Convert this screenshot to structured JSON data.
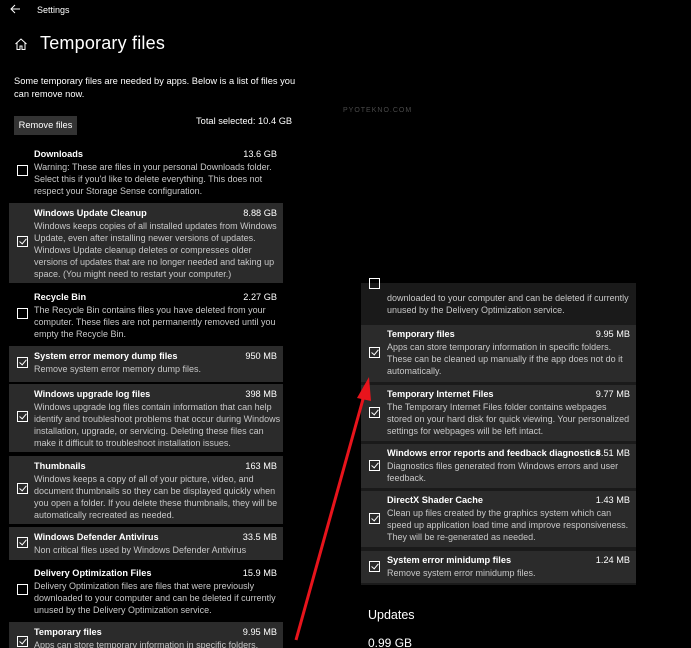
{
  "titlebar": {
    "app_title": "Settings",
    "back_icon": "back-arrow-icon"
  },
  "page": {
    "title": "Temporary files",
    "intro": "Some temporary files are needed by apps. Below is a list of files you can remove now.",
    "remove_button": "Remove files",
    "total_selected": "Total selected: 10.4 GB",
    "watermark": "PYOTEKNO.COM"
  },
  "items": [
    {
      "name": "Downloads",
      "size": "13.6 GB",
      "checked": false,
      "selected": false,
      "desc": "Warning: These are files in your personal Downloads folder. Select this if you'd like to delete everything. This does not respect your Storage Sense configuration."
    },
    {
      "name": "Windows Update Cleanup",
      "size": "8.88 GB",
      "checked": true,
      "selected": true,
      "desc": "Windows keeps copies of all installed updates from Windows Update, even after installing newer versions of updates. Windows Update cleanup deletes or compresses older versions of updates that are no longer needed and taking up space. (You might need to restart your computer.)"
    },
    {
      "name": "Recycle Bin",
      "size": "2.27 GB",
      "checked": false,
      "selected": false,
      "desc": "The Recycle Bin contains files you have deleted from your computer. These files are not permanently removed until you empty the Recycle Bin."
    },
    {
      "name": "System error memory dump files",
      "size": "950 MB",
      "checked": true,
      "selected": true,
      "desc": "Remove system error memory dump files."
    },
    {
      "name": "Windows upgrade log files",
      "size": "398 MB",
      "checked": true,
      "selected": true,
      "desc": "Windows upgrade log files contain information that can help identify and troubleshoot problems that occur during Windows installation, upgrade, or servicing.  Deleting these files can make it difficult to troubleshoot installation issues."
    },
    {
      "name": "Thumbnails",
      "size": "163 MB",
      "checked": true,
      "selected": true,
      "desc": "Windows keeps a copy of all of your picture, video, and document thumbnails so they can be displayed quickly when you open a folder. If you delete these thumbnails, they will be automatically recreated as needed."
    },
    {
      "name": "Windows Defender Antivirus",
      "size": "33.5 MB",
      "checked": true,
      "selected": true,
      "desc": "Non critical files used by Windows Defender Antivirus"
    },
    {
      "name": "Delivery Optimization Files",
      "size": "15.9 MB",
      "checked": false,
      "selected": false,
      "desc": "Delivery Optimization files are files that were previously downloaded to your computer and can be deleted if currently unused by the Delivery Optimization service."
    },
    {
      "name": "Temporary files",
      "size": "9.95 MB",
      "checked": true,
      "selected": true,
      "desc": "Apps can store temporary information in specific folders."
    }
  ],
  "right_pane": {
    "partial_desc": "downloaded to your computer and can be deleted if currently unused by the Delivery Optimization service.",
    "items": [
      {
        "name": "Temporary files",
        "size": "9.95 MB",
        "checked": true,
        "desc": "Apps can store temporary information in specific folders. These can be cleaned up manually if the app does not do it automatically."
      },
      {
        "name": "Temporary Internet Files",
        "size": "9.77 MB",
        "checked": true,
        "desc": "The Temporary Internet Files folder contains webpages stored on your hard disk for quick viewing. Your personalized settings for webpages will be left intact."
      },
      {
        "name": "Windows error reports and feedback diagnostics",
        "size": "8.51 MB",
        "checked": true,
        "desc": "Diagnostics files generated from Windows errors and user feedback."
      },
      {
        "name": "DirectX Shader Cache",
        "size": "1.43 MB",
        "checked": true,
        "desc": "Clean up files created by the graphics system which can speed up application load time and improve responsiveness. They will be re-generated as needed."
      },
      {
        "name": "System error minidump files",
        "size": "1.24 MB",
        "checked": true,
        "desc": "Remove system error minidump files."
      }
    ]
  },
  "updates": {
    "title": "Updates",
    "size": "0.99 GB"
  },
  "colors": {
    "background": "#000000",
    "selected_row": "#2b2b2b",
    "arrow": "#e8141c"
  }
}
